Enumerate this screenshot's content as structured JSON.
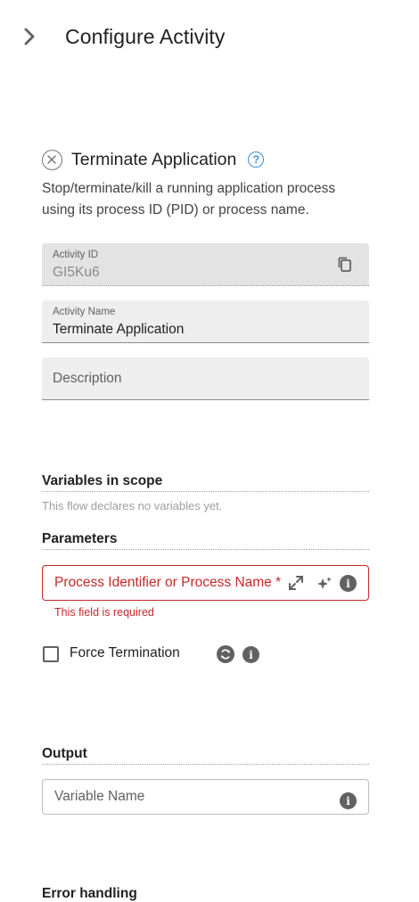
{
  "header": {
    "title": "Configure Activity"
  },
  "activity": {
    "title": "Terminate Application",
    "description": "Stop/terminate/kill a running application process using its process ID (PID) or process name."
  },
  "fields": {
    "activity_id": {
      "label": "Activity ID",
      "value": "GI5Ku6"
    },
    "activity_name": {
      "label": "Activity Name",
      "value": "Terminate Application"
    },
    "description": {
      "placeholder": "Description"
    }
  },
  "variables": {
    "heading": "Variables in scope",
    "hint": "This flow declares no variables yet."
  },
  "parameters": {
    "heading": "Parameters",
    "process_field": {
      "label": "Process Identifier or Process Name",
      "required_mark": "*",
      "error": "This field is required"
    },
    "force_termination": {
      "label": "Force Termination",
      "checked": false
    }
  },
  "output": {
    "heading": "Output",
    "variable_name": {
      "placeholder": "Variable Name"
    }
  },
  "next_section": {
    "heading": "Error handling"
  },
  "icons": {
    "back": "chevron-right-icon",
    "remove": "close-circle-icon",
    "help": "help-circle-icon",
    "copy": "copy-icon",
    "expand": "expand-icon",
    "ai": "sparkle-icon",
    "info": "info-icon",
    "refresh": "refresh-icon"
  },
  "colors": {
    "accent": "#3b8be0",
    "error": "#c62828",
    "field_bg": "#eeeeee"
  }
}
